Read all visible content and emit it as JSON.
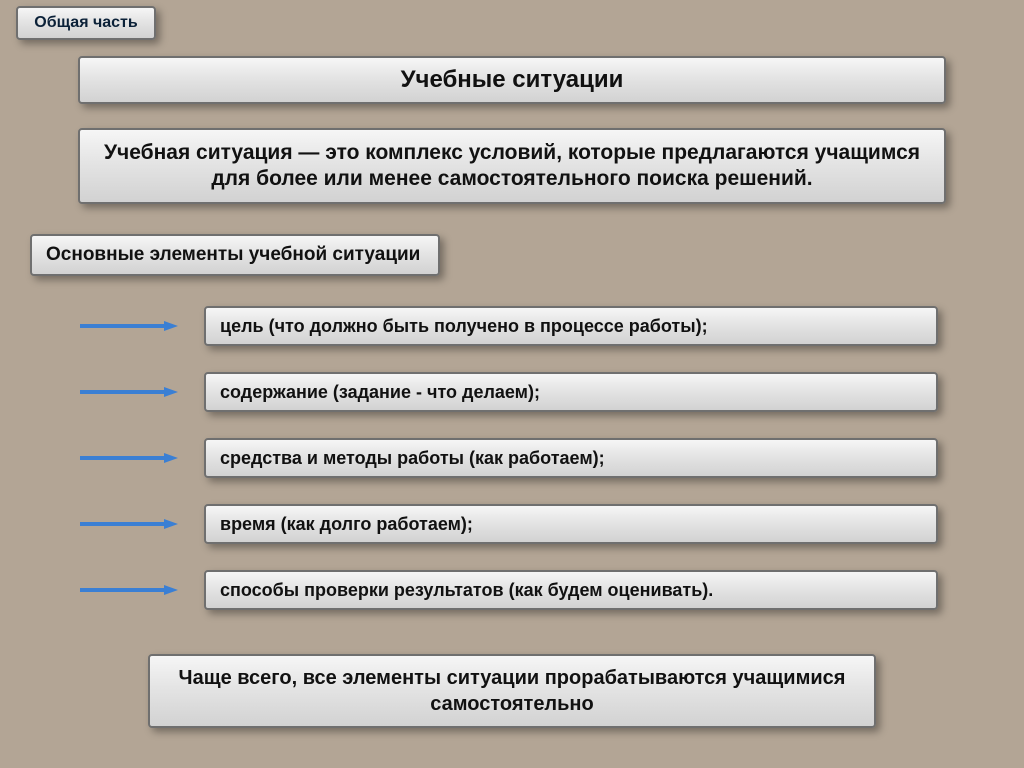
{
  "badge": "Общая часть",
  "title": "Учебные ситуации",
  "definition": "Учебная ситуация — это комплекс условий, которые предлагаются учащимся для более или менее самостоятельного поиска решений.",
  "sub_heading": "Основные элементы учебной ситуации",
  "arrow_color": "#3a7fd4",
  "items": [
    "цель (что должно быть получено в процессе работы);",
    "содержание (задание - что делаем);",
    "средства и методы работы (как работаем);",
    "время (как долго работаем);",
    "способы проверки результатов (как будем оценивать)."
  ],
  "footer": "Чаще всего, все элементы ситуации прорабатываются учащимися самостоятельно"
}
